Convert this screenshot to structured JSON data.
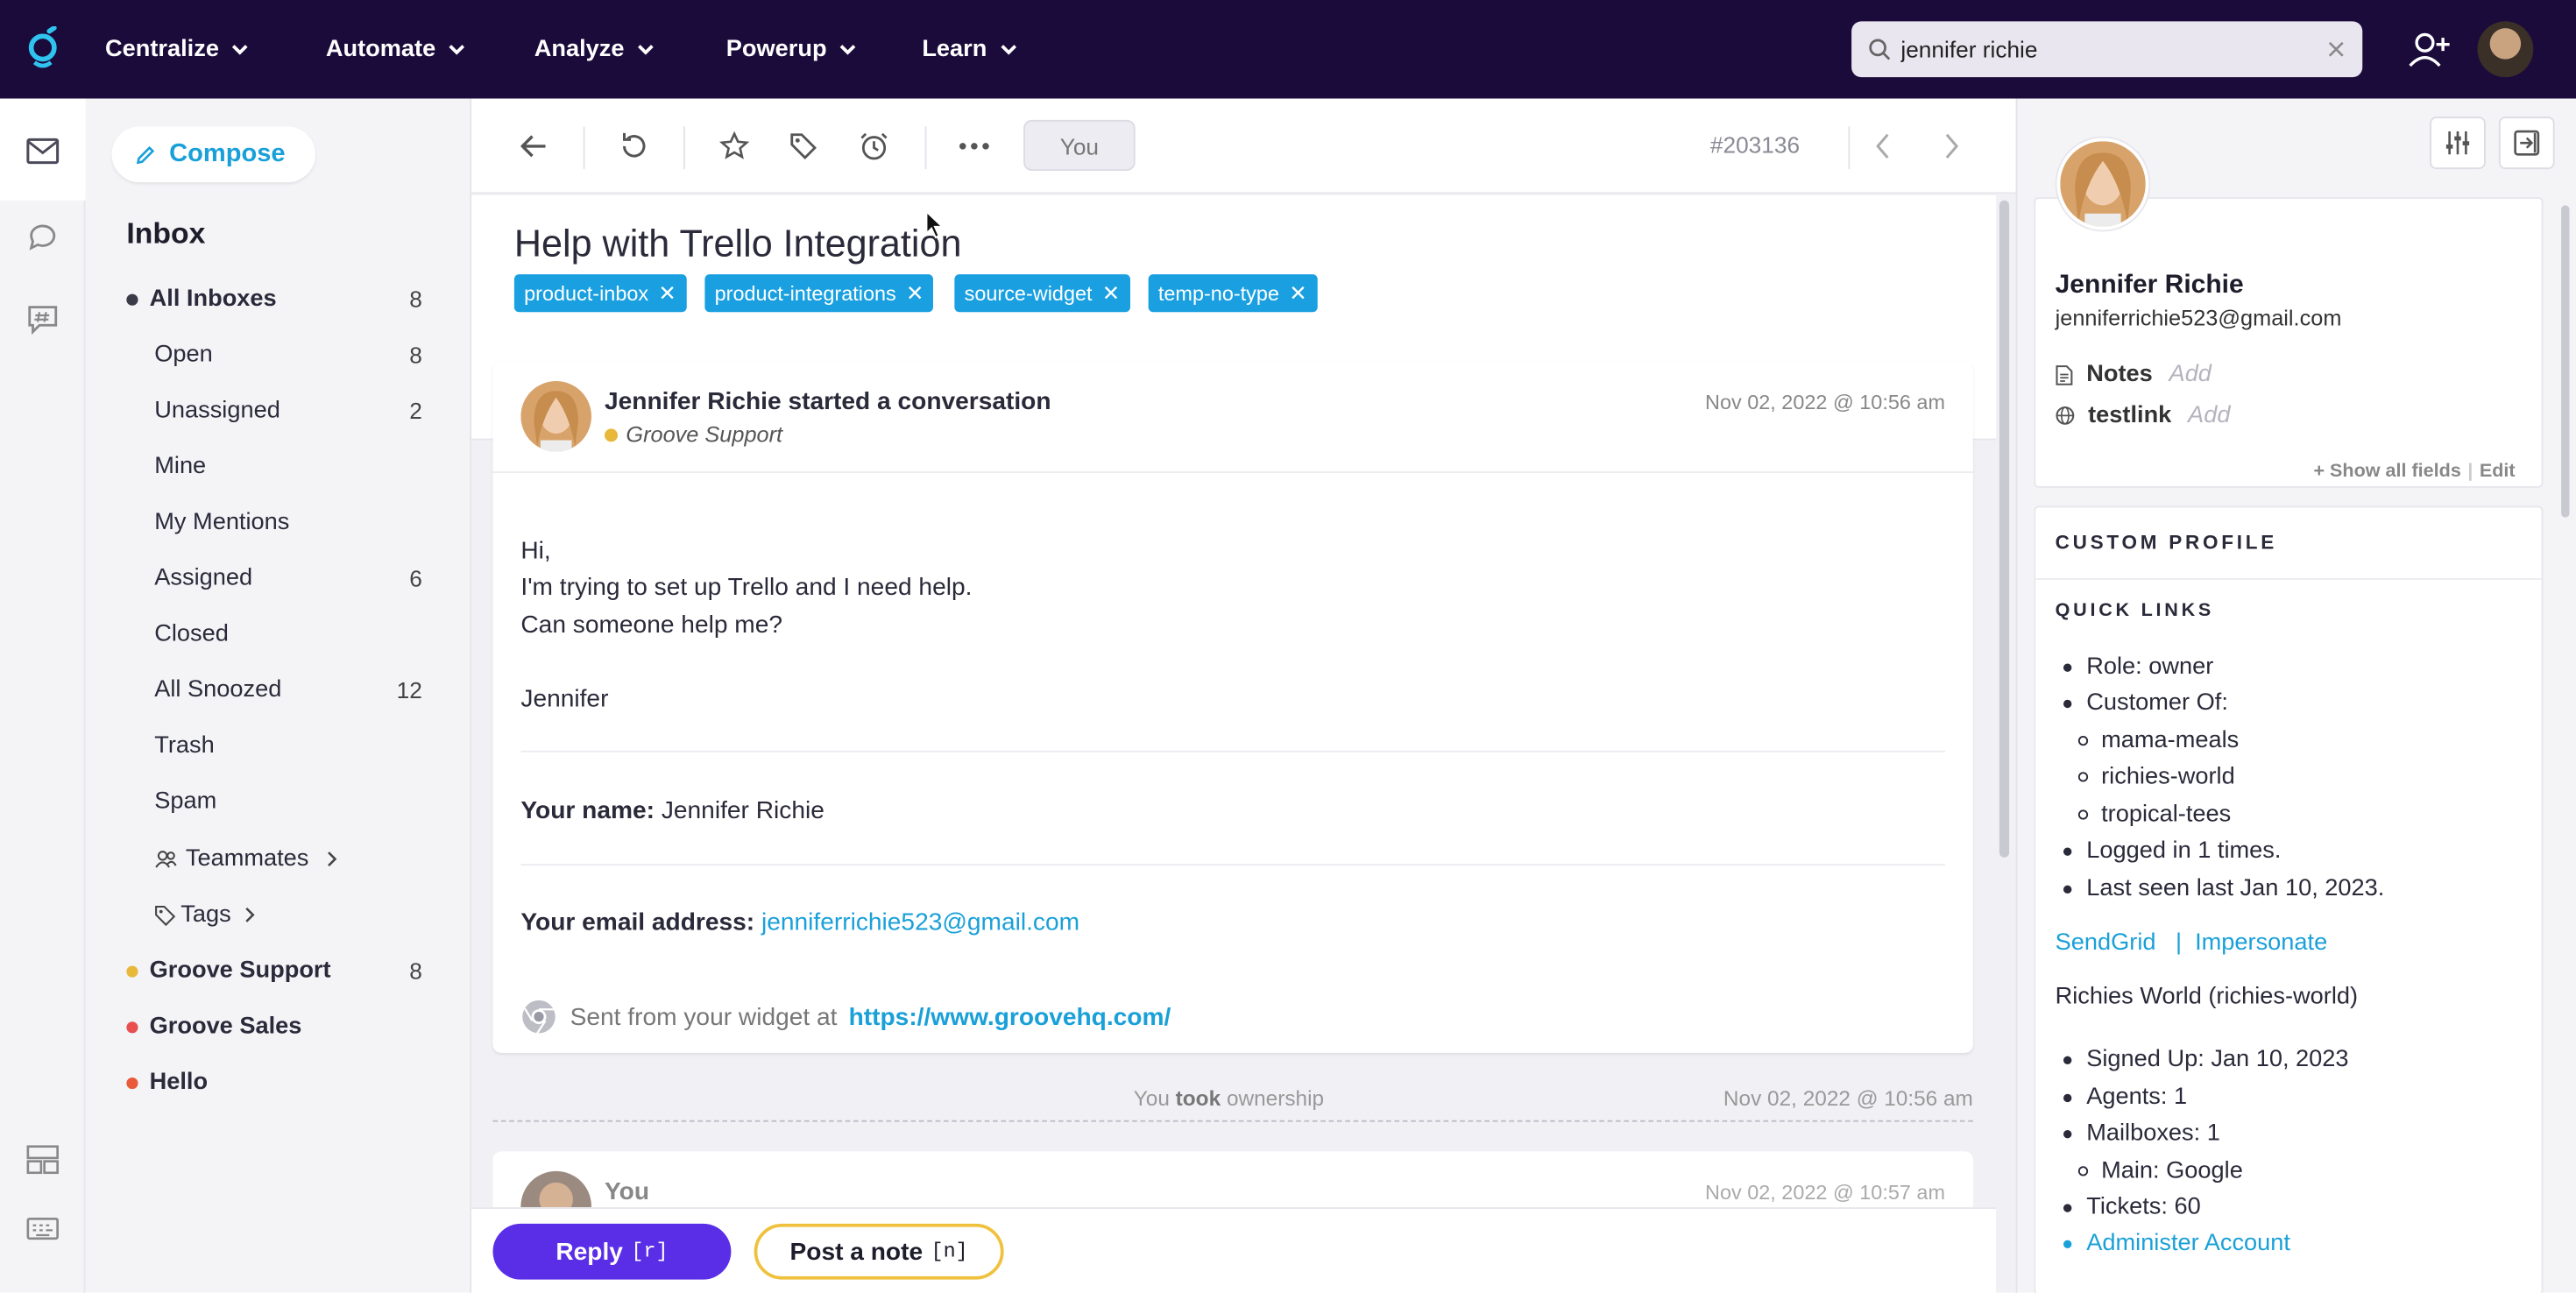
{
  "topbar": {
    "nav": [
      "Centralize",
      "Automate",
      "Analyze",
      "Powerup",
      "Learn"
    ],
    "search_value": "jennifer richie"
  },
  "sidebar": {
    "compose_label": "Compose",
    "inbox_title": "Inbox",
    "folders": [
      {
        "label": "All Inboxes",
        "count": "8"
      },
      {
        "label": "Open",
        "count": "8"
      },
      {
        "label": "Unassigned",
        "count": "2"
      },
      {
        "label": "Mine",
        "count": ""
      },
      {
        "label": "My Mentions",
        "count": ""
      },
      {
        "label": "Assigned",
        "count": "6"
      },
      {
        "label": "Closed",
        "count": ""
      },
      {
        "label": "All Snoozed",
        "count": "12"
      },
      {
        "label": "Trash",
        "count": ""
      },
      {
        "label": "Spam",
        "count": ""
      },
      {
        "label": "Teammates",
        "count": ""
      },
      {
        "label": "Tags",
        "count": ""
      },
      {
        "label": "Groove Support",
        "count": "8"
      },
      {
        "label": "Groove Sales",
        "count": ""
      },
      {
        "label": "Hello",
        "count": ""
      }
    ],
    "mailbox_colors": {
      "support": "#e8b83a",
      "sales": "#e85050",
      "hello": "#e85a3a"
    }
  },
  "toolbar": {
    "you_label": "You",
    "ticket_number": "#203136"
  },
  "conversation": {
    "subject": "Help with Trello Integration",
    "tags": [
      "product-inbox",
      "product-integrations",
      "source-widget",
      "temp-no-type"
    ],
    "message": {
      "from_line": "Jennifer Richie started a conversation",
      "mailbox": "Groove Support",
      "date": "Nov 02, 2022 @ 10:56 am",
      "lines": [
        "Hi,",
        "I'm trying to set up Trello and I need help.",
        "Can someone help me?",
        "Jennifer"
      ],
      "name_label": "Your name:",
      "name_value": "Jennifer Richie",
      "email_label": "Your email address:",
      "email_value": "jenniferrichie523@gmail.com",
      "widget_text": "Sent from your widget at",
      "widget_url": "https://www.groovehq.com/"
    },
    "event": {
      "pre": "You",
      "verb": "took",
      "post": "ownership",
      "date": "Nov 02, 2022 @ 10:56 am"
    },
    "message2": {
      "from": "You",
      "date": "Nov 02, 2022 @ 10:57 am"
    },
    "reply_label": "Reply",
    "reply_key": "[r]",
    "note_label": "Post a note",
    "note_key": "[n]"
  },
  "customer": {
    "name": "Jennifer Richie",
    "email": "jenniferrichie523@gmail.com",
    "fields": [
      {
        "label": "Notes",
        "add": "Add"
      },
      {
        "label": "testlink",
        "add": "Add"
      }
    ],
    "show_all": "+ Show all fields",
    "edit": "Edit",
    "custom_profile_title": "CUSTOM PROFILE",
    "quick_links_title": "QUICK LINKS",
    "quick": {
      "role": "Role: owner",
      "customer_of": "Customer Of:",
      "customers": [
        "mama-meals",
        "richies-world",
        "tropical-tees"
      ],
      "logged": "Logged in 1 times.",
      "last_seen": "Last seen last Jan 10, 2023.",
      "sendgrid": "SendGrid",
      "pipe": "|",
      "impersonate": "Impersonate",
      "account_name": "Richies World (richies-world)",
      "signed_up": "Signed Up: Jan 10, 2023",
      "agents": "Agents: 1",
      "mailboxes": "Mailboxes: 1",
      "main": "Main: Google",
      "tickets": "Tickets: 60",
      "administer": "Administer Account"
    }
  }
}
